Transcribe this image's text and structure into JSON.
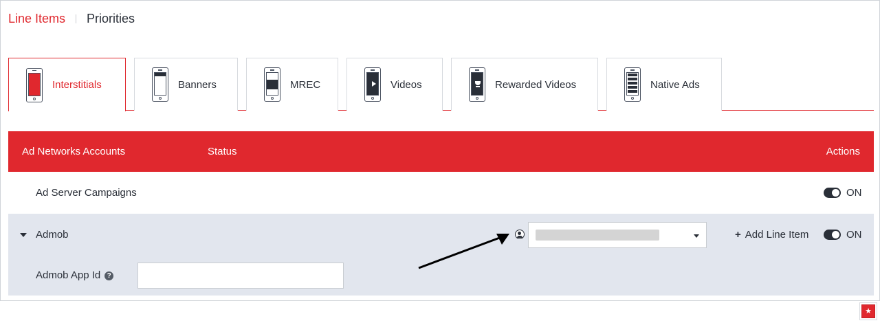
{
  "topnav": {
    "line_items": "Line Items",
    "priorities": "Priorities"
  },
  "tabs": [
    {
      "label": "Interstitials",
      "icon": "interstitial-phone-icon",
      "active": true
    },
    {
      "label": "Banners",
      "icon": "banner-phone-icon",
      "active": false
    },
    {
      "label": "MREC",
      "icon": "mrec-phone-icon",
      "active": false
    },
    {
      "label": "Videos",
      "icon": "video-phone-icon",
      "active": false
    },
    {
      "label": "Rewarded Videos",
      "icon": "rewarded-video-phone-icon",
      "active": false
    },
    {
      "label": "Native Ads",
      "icon": "native-ads-phone-icon",
      "active": false
    }
  ],
  "table": {
    "headers": {
      "accounts": "Ad Networks Accounts",
      "status": "Status",
      "actions": "Actions"
    },
    "rows": [
      {
        "name": "Ad Server Campaigns",
        "toggle": "ON"
      },
      {
        "name": "Admob",
        "toggle": "ON",
        "add_line_item": "Add Line Item",
        "account_select_value": "",
        "app_id_label": "Admob App Id",
        "app_id_value": ""
      }
    ]
  },
  "colors": {
    "accent": "#e0282e",
    "row_highlight": "#e2e6ee",
    "text": "#2a2f38"
  }
}
